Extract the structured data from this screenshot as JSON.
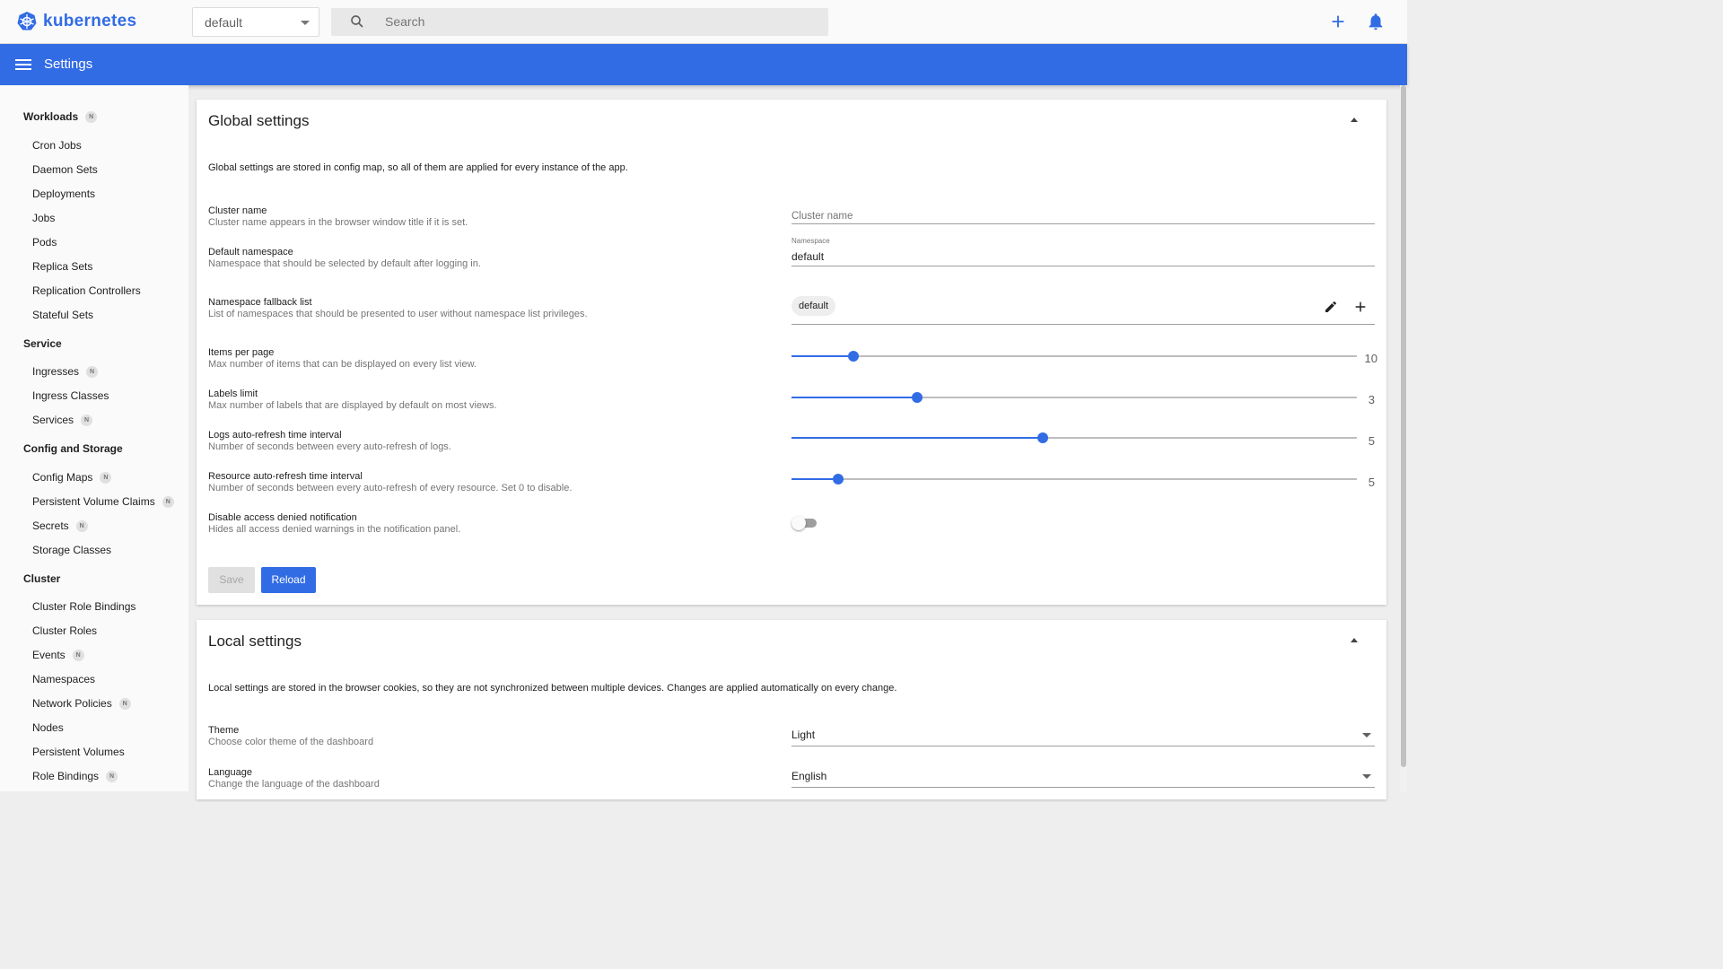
{
  "app": {
    "logo_text": "kubernetes",
    "namespace_selected": "default",
    "search_placeholder": "Search",
    "header_title": "Settings",
    "brand_color": "#326ce5"
  },
  "sidebar": {
    "sections": [
      {
        "label": "Workloads",
        "badge": "N",
        "items": [
          {
            "label": "Cron Jobs"
          },
          {
            "label": "Daemon Sets"
          },
          {
            "label": "Deployments"
          },
          {
            "label": "Jobs"
          },
          {
            "label": "Pods"
          },
          {
            "label": "Replica Sets"
          },
          {
            "label": "Replication Controllers"
          },
          {
            "label": "Stateful Sets"
          }
        ]
      },
      {
        "label": "Service",
        "items": [
          {
            "label": "Ingresses",
            "badge": "N"
          },
          {
            "label": "Ingress Classes"
          },
          {
            "label": "Services",
            "badge": "N"
          }
        ]
      },
      {
        "label": "Config and Storage",
        "items": [
          {
            "label": "Config Maps",
            "badge": "N"
          },
          {
            "label": "Persistent Volume Claims",
            "badge": "N"
          },
          {
            "label": "Secrets",
            "badge": "N"
          },
          {
            "label": "Storage Classes"
          }
        ]
      },
      {
        "label": "Cluster",
        "items": [
          {
            "label": "Cluster Role Bindings"
          },
          {
            "label": "Cluster Roles"
          },
          {
            "label": "Events",
            "badge": "N"
          },
          {
            "label": "Namespaces"
          },
          {
            "label": "Network Policies",
            "badge": "N"
          },
          {
            "label": "Nodes"
          },
          {
            "label": "Persistent Volumes"
          },
          {
            "label": "Role Bindings",
            "badge": "N"
          }
        ]
      }
    ]
  },
  "global": {
    "title": "Global settings",
    "description": "Global settings are stored in config map, so all of them are applied for every instance of the app.",
    "cluster_name": {
      "label": "Cluster name",
      "sub": "Cluster name appears in the browser window title if it is set.",
      "placeholder": "Cluster name",
      "value": ""
    },
    "default_namespace": {
      "label": "Default namespace",
      "sub": "Namespace that should be selected by default after logging in.",
      "field_label": "Namespace",
      "value": "default"
    },
    "fallback": {
      "label": "Namespace fallback list",
      "sub": "List of namespaces that should be presented to user without namespace list privileges.",
      "chips": [
        "default"
      ]
    },
    "items_per_page": {
      "label": "Items per page",
      "sub": "Max number of items that can be displayed on every list view.",
      "value": "10",
      "fraction": 0.11
    },
    "labels_limit": {
      "label": "Labels limit",
      "sub": "Max number of labels that are displayed by default on most views.",
      "value": "3",
      "fraction": 0.222
    },
    "logs_refresh": {
      "label": "Logs auto-refresh time interval",
      "sub": "Number of seconds between every auto-refresh of logs.",
      "value": "5",
      "fraction": 0.444
    },
    "resource_refresh": {
      "label": "Resource auto-refresh time interval",
      "sub": "Number of seconds between every auto-refresh of every resource. Set 0 to disable.",
      "value": "5",
      "fraction": 0.083
    },
    "access_denied": {
      "label": "Disable access denied notification",
      "sub": "Hides all access denied warnings in the notification panel.",
      "enabled": false
    },
    "save_label": "Save",
    "reload_label": "Reload"
  },
  "local": {
    "title": "Local settings",
    "description": "Local settings are stored in the browser cookies, so they are not synchronized between multiple devices. Changes are applied automatically on every change.",
    "theme": {
      "label": "Theme",
      "sub": "Choose color theme of the dashboard",
      "value": "Light"
    },
    "language": {
      "label": "Language",
      "sub": "Change the language of the dashboard",
      "value": "English"
    }
  }
}
